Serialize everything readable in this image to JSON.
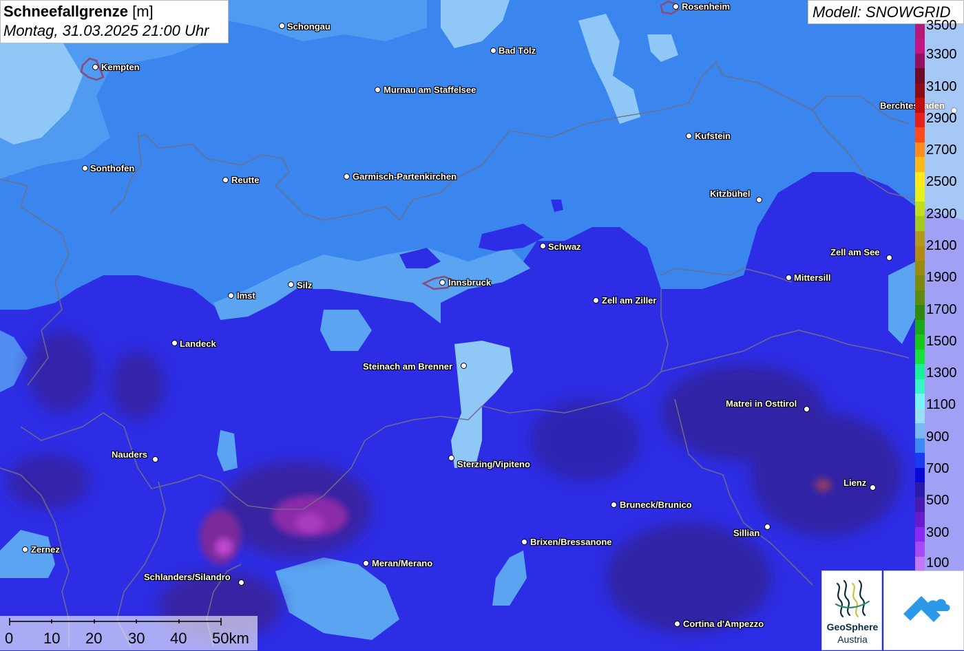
{
  "header": {
    "title_bold": "Schneefallgrenze",
    "title_unit": "[m]",
    "subtitle": "Montag, 31.03.2025 21:00 Uhr",
    "model": "Modell: SNOWGRID"
  },
  "cities": [
    {
      "name": "Rosenheim"
    },
    {
      "name": "Schongau"
    },
    {
      "name": "Bad Tölz"
    },
    {
      "name": "Kempten"
    },
    {
      "name": "Murnau am Staffelsee"
    },
    {
      "name": "Berchtesgaden"
    },
    {
      "name": "Kufstein"
    },
    {
      "name": "Sonthofen"
    },
    {
      "name": "Reutte"
    },
    {
      "name": "Garmisch-Partenkirchen"
    },
    {
      "name": "Kitzbühel"
    },
    {
      "name": "Schwaz"
    },
    {
      "name": "Zell am See"
    },
    {
      "name": "Innsbruck"
    },
    {
      "name": "Silz"
    },
    {
      "name": "Mittersill"
    },
    {
      "name": "Imst"
    },
    {
      "name": "Zell am Ziller"
    },
    {
      "name": "Landeck"
    },
    {
      "name": "Steinach am Brenner"
    },
    {
      "name": "Matrei in Osttirol"
    },
    {
      "name": "Nauders"
    },
    {
      "name": "Sterzing/Vipiteno"
    },
    {
      "name": "Lienz"
    },
    {
      "name": "Bruneck/Brunico"
    },
    {
      "name": "Sillian"
    },
    {
      "name": "Brixen/Bressanone"
    },
    {
      "name": "Zernez"
    },
    {
      "name": "Meran/Merano"
    },
    {
      "name": "Schlanders/Silandro"
    },
    {
      "name": "Cortina d'Ampezzo"
    }
  ],
  "legend": {
    "labels": [
      "3500",
      "3300",
      "3100",
      "2900",
      "2700",
      "2500",
      "2300",
      "2100",
      "1900",
      "1700",
      "1500",
      "1300",
      "1100",
      "900",
      "700",
      "500",
      "300",
      "100"
    ],
    "colors": [
      "#b51a7a",
      "#c21683",
      "#94105e",
      "#6e0a25",
      "#8d0a10",
      "#c00e0e",
      "#e8201c",
      "#ff4a1a",
      "#ff8c1a",
      "#ffba1a",
      "#ffe81a",
      "#e8f21a",
      "#c2dd1a",
      "#a8c81a",
      "#b39a1a",
      "#b38b12",
      "#9a8c0c",
      "#7e8a0e",
      "#5e8a0e",
      "#2e8a0e",
      "#1aa81a",
      "#1ac81a",
      "#1ae03a",
      "#1af09a",
      "#3af4c8",
      "#7af4f4",
      "#9ae0f4",
      "#7ab8f4",
      "#3a8af4",
      "#1a3af4",
      "#0a0ad8",
      "#2a1aa8",
      "#4a1ab0",
      "#6a1ac8",
      "#8a2af0",
      "#a84af4",
      "#c07af4"
    ]
  },
  "scale_bar": {
    "labels": [
      "0",
      "10",
      "20",
      "30",
      "40",
      "50km"
    ]
  },
  "logos": {
    "geosphere_line1": "GeoSphere",
    "geosphere_line2": "Austria"
  }
}
